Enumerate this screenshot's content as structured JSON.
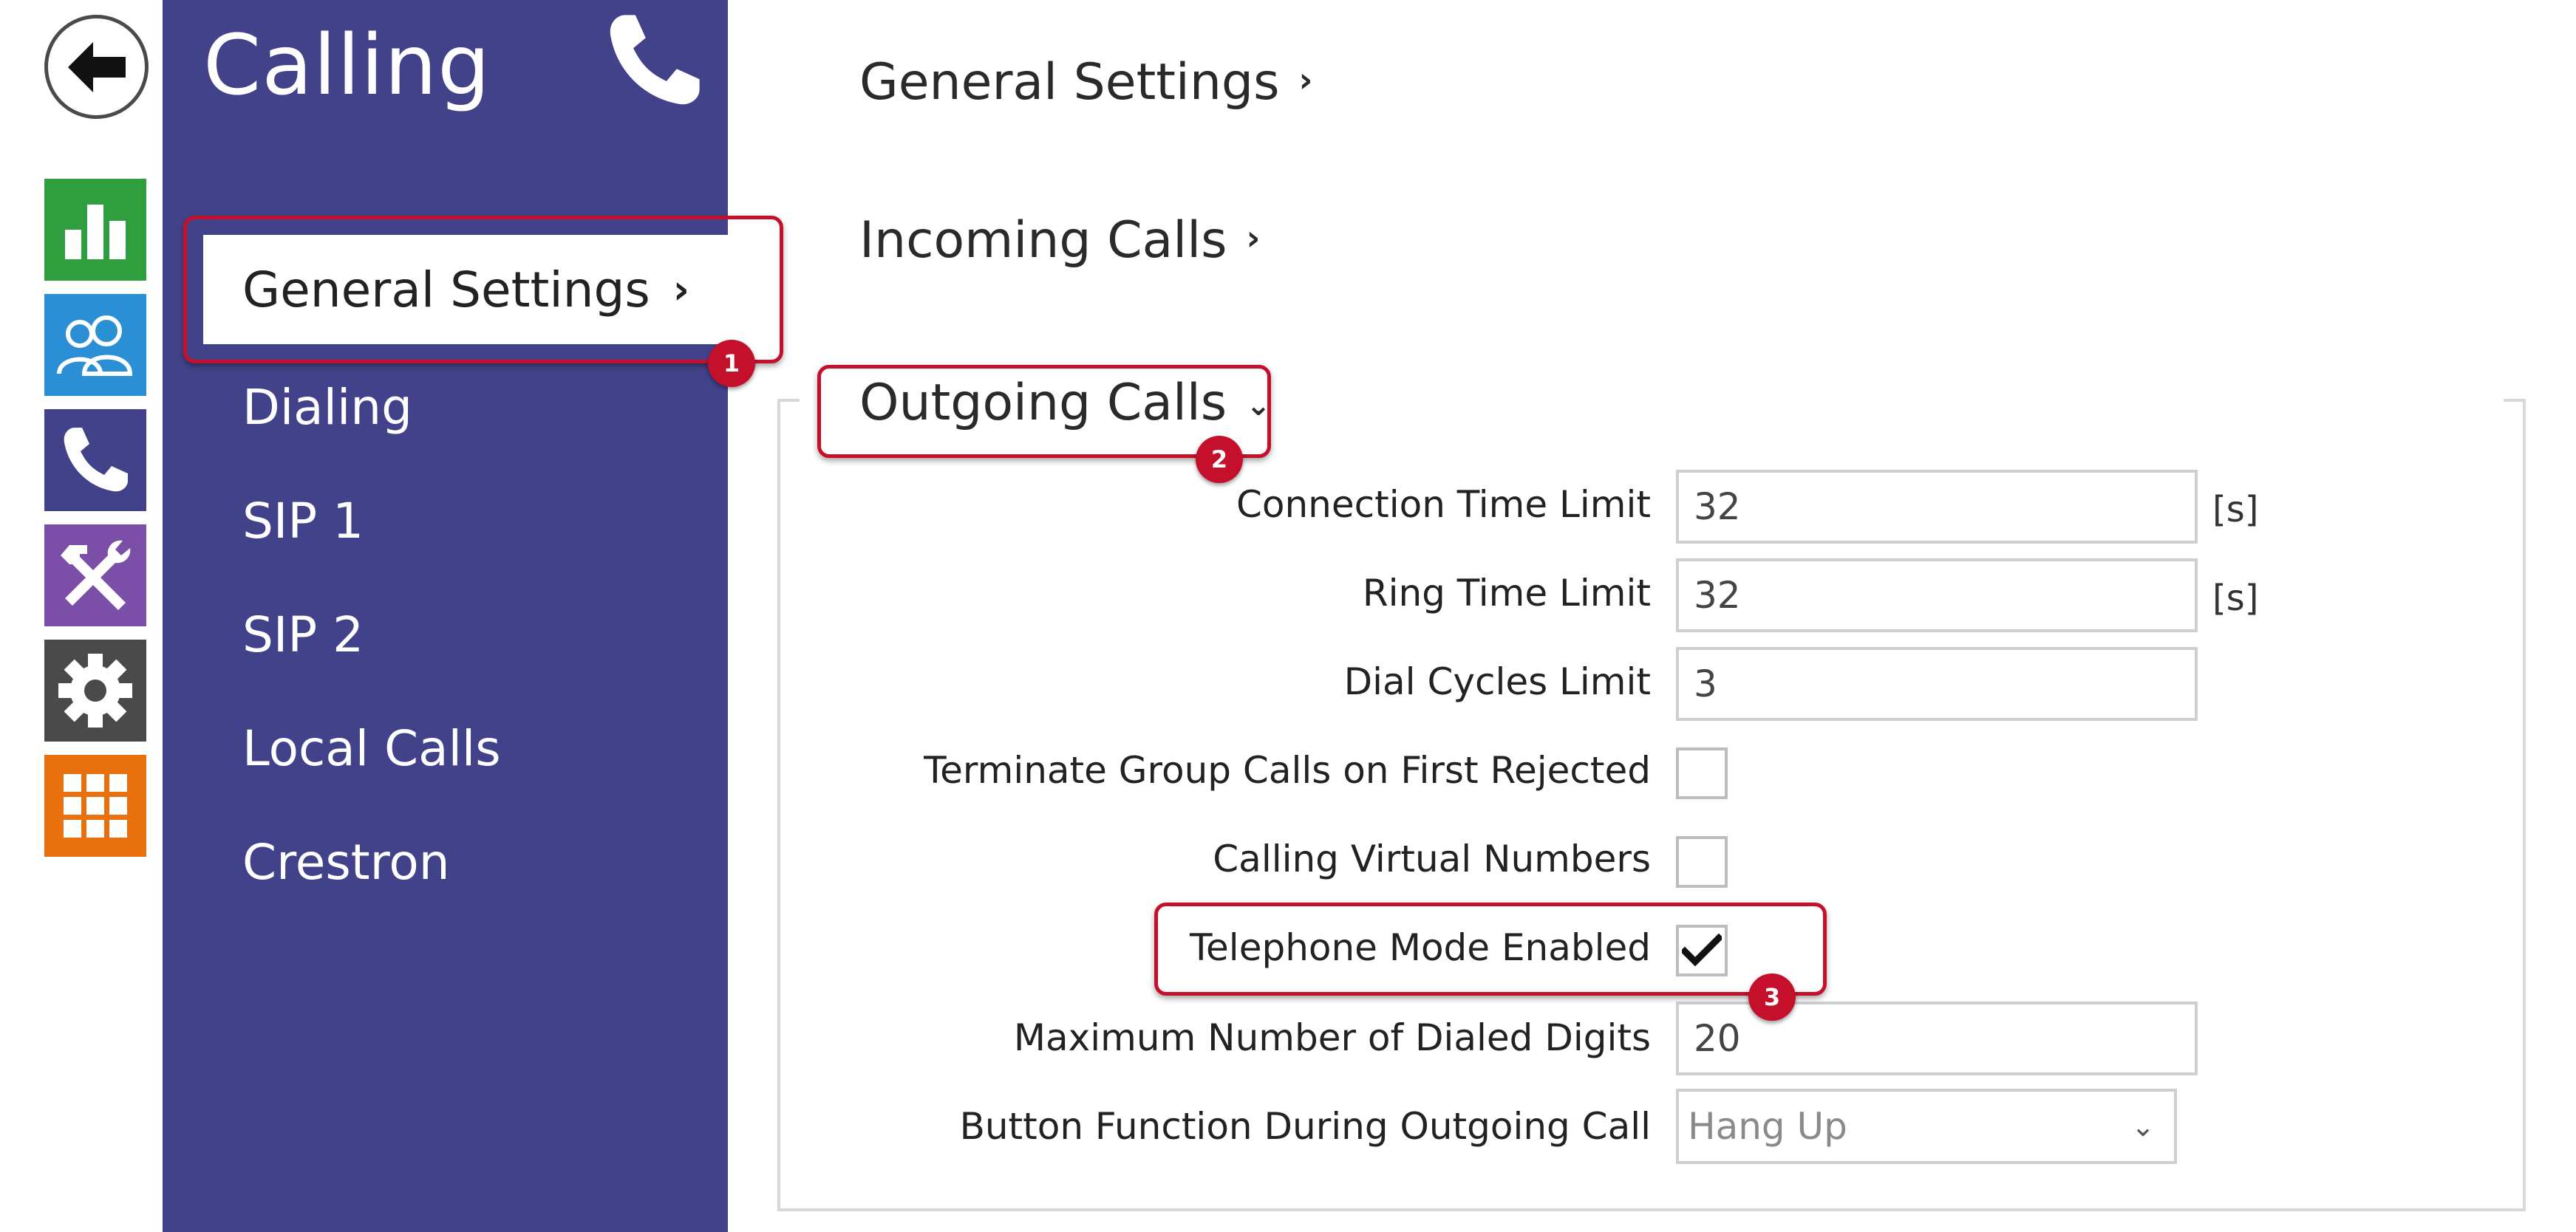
{
  "app": {
    "title": "Calling"
  },
  "rail": {
    "items": [
      {
        "icon": "bar-chart-icon",
        "color": "#2e9e3e"
      },
      {
        "icon": "users-icon",
        "color": "#2b8fd6"
      },
      {
        "icon": "phone-icon",
        "color": "#42428a"
      },
      {
        "icon": "tools-icon",
        "color": "#7b4fa8"
      },
      {
        "icon": "gear-icon",
        "color": "#4a4a4a"
      },
      {
        "icon": "grid-icon",
        "color": "#e8700f"
      }
    ]
  },
  "sidebar": {
    "items": [
      {
        "label": "General Settings",
        "active": true
      },
      {
        "label": "Dialing"
      },
      {
        "label": "SIP 1"
      },
      {
        "label": "SIP 2"
      },
      {
        "label": "Local Calls"
      },
      {
        "label": "Crestron"
      }
    ]
  },
  "main": {
    "sections": [
      {
        "label": "General Settings",
        "expanded": false
      },
      {
        "label": "Incoming Calls",
        "expanded": false
      },
      {
        "label": "Outgoing Calls",
        "expanded": true
      }
    ],
    "fields": {
      "connection_time_limit": {
        "label": "Connection Time Limit",
        "value": "32",
        "unit": "[s]"
      },
      "ring_time_limit": {
        "label": "Ring Time Limit",
        "value": "32",
        "unit": "[s]"
      },
      "dial_cycles_limit": {
        "label": "Dial Cycles Limit",
        "value": "3"
      },
      "terminate_group_calls": {
        "label": "Terminate Group Calls on First Rejected",
        "checked": false
      },
      "calling_virtual_numbers": {
        "label": "Calling Virtual Numbers",
        "checked": false
      },
      "telephone_mode_enabled": {
        "label": "Telephone Mode Enabled",
        "checked": true
      },
      "max_dialed_digits": {
        "label": "Maximum Number of Dialed Digits",
        "value": "20"
      },
      "button_function": {
        "label": "Button Function During Outgoing Call",
        "value": "Hang Up"
      }
    }
  },
  "callouts": [
    {
      "number": "1"
    },
    {
      "number": "2"
    },
    {
      "number": "3"
    }
  ],
  "colors": {
    "sidebar_bg": "#42428a",
    "callout_red": "#c4102a"
  }
}
